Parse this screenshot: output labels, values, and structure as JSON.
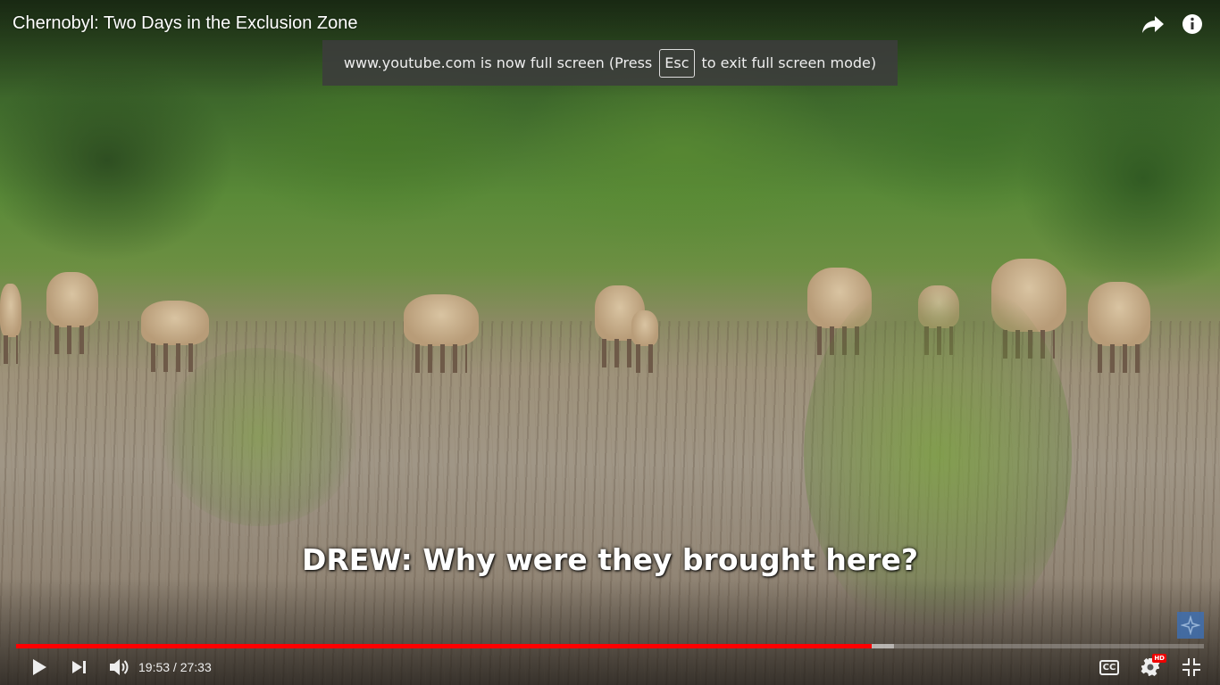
{
  "video": {
    "title": "Chernobyl: Two Days in the Exclusion Zone",
    "caption": "DREW: Why were they brought here?"
  },
  "fullscreen_notice": {
    "before": "www.youtube.com is now full screen (Press",
    "key": "Esc",
    "after": "to exit full screen mode)"
  },
  "player": {
    "current_time": "19:53",
    "separator": " / ",
    "duration": "27:33",
    "played_fraction": 0.72,
    "loaded_fraction": 0.739,
    "cc_label": "CC",
    "hd_badge": "HD",
    "accent_color": "#ff0000"
  },
  "icons": {
    "share": "share-icon",
    "info": "info-icon",
    "play": "play-icon",
    "next": "next-icon",
    "volume": "volume-icon",
    "captions": "captions-icon",
    "settings": "gear-icon",
    "exit_fullscreen": "exit-fullscreen-icon"
  }
}
